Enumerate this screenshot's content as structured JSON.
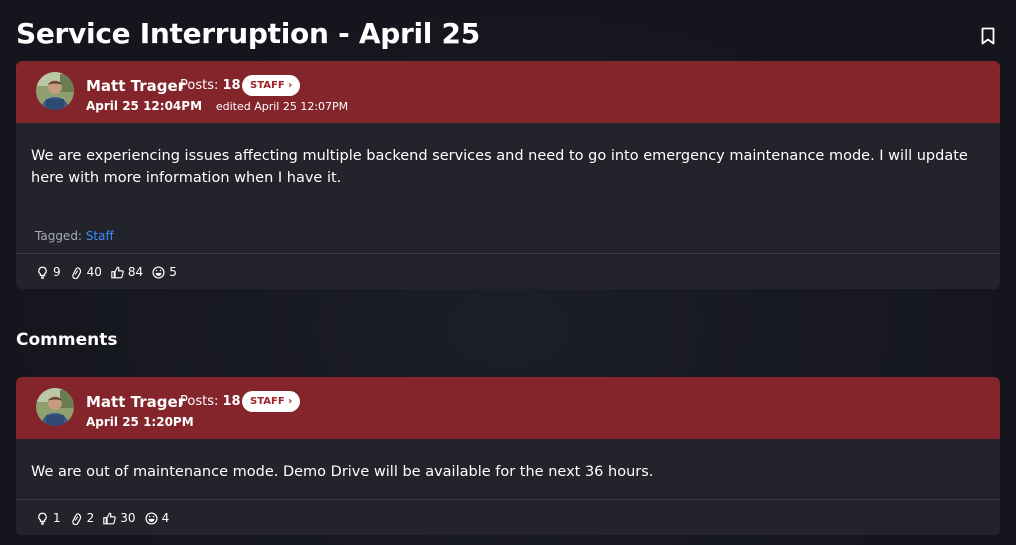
{
  "post": {
    "title": "Service Interruption - April 25",
    "author": "Matt Trager",
    "posts_label": "Posts:",
    "posts_count": "18",
    "badge": "STAFF ›",
    "date": "April 25 12:04PM",
    "edited": "edited April 25 12:07PM",
    "body": "We are experiencing issues affecting multiple backend services and need to go into emergency maintenance mode. I will update here with more information when I have it.",
    "tagged_label": "Tagged:",
    "tag": "Staff",
    "reactions": [
      {
        "icon": "lightbulb-icon",
        "count": "9"
      },
      {
        "icon": "thinking-icon",
        "count": "40"
      },
      {
        "icon": "thumbs-up-icon",
        "count": "84"
      },
      {
        "icon": "laughing-icon",
        "count": "5"
      }
    ]
  },
  "comments": {
    "heading": "Comments",
    "items": [
      {
        "author": "Matt Trager",
        "posts_label": "Posts:",
        "posts_count": "18",
        "badge": "STAFF ›",
        "date": "April 25 1:20PM",
        "body": "We are out of maintenance mode. Demo Drive will be available for the next 36 hours.",
        "reactions": [
          {
            "icon": "lightbulb-icon",
            "count": "1"
          },
          {
            "icon": "thinking-icon",
            "count": "2"
          },
          {
            "icon": "thumbs-up-icon",
            "count": "30"
          },
          {
            "icon": "laughing-icon",
            "count": "4"
          }
        ]
      }
    ]
  },
  "colors": {
    "header": "#83252b",
    "card": "#22232b",
    "link": "#3a8eff",
    "badge_text": "#a0242b"
  }
}
